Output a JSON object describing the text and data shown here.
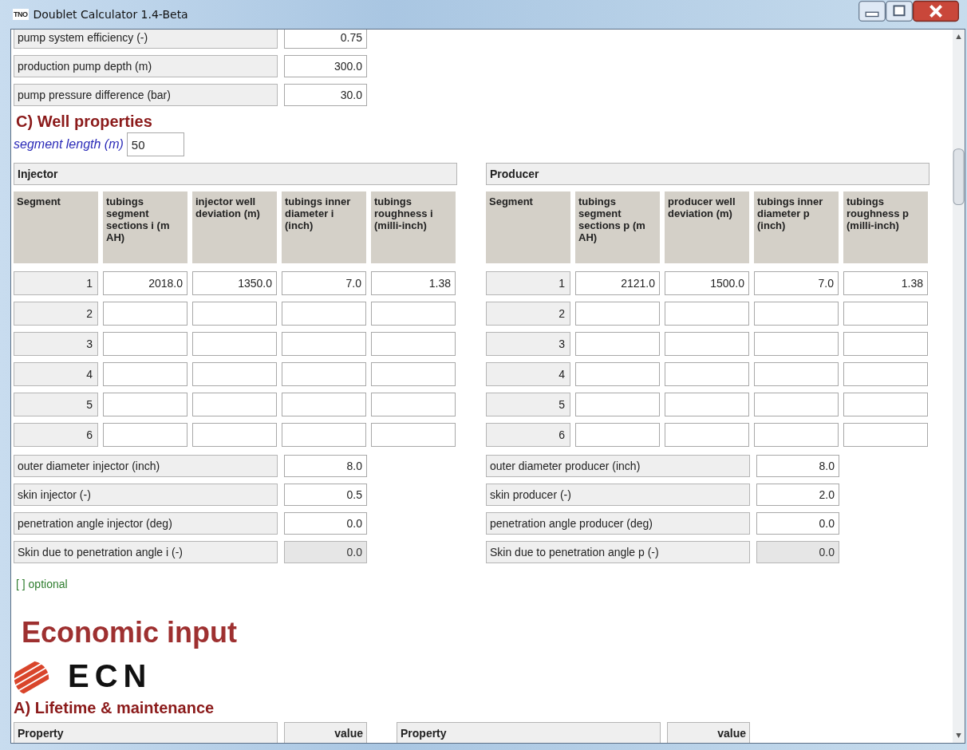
{
  "window": {
    "icon_text": "TNO",
    "title": "Doublet Calculator 1.4-Beta"
  },
  "top_properties": [
    {
      "label": "pump system efficiency (-)",
      "value": "0.75"
    },
    {
      "label": "production pump depth (m)",
      "value": "300.0"
    },
    {
      "label": "pump pressure difference (bar)",
      "value": "30.0"
    }
  ],
  "well_heading": "C) Well properties",
  "segment_length": {
    "label": "segment length (m)",
    "value": "50"
  },
  "wells": [
    {
      "title": "Injector",
      "columns": [
        "Segment",
        "tubings segment sections i (m AH)",
        "injector well deviation (m)",
        "tubings inner diameter i (inch)",
        "tubings roughness i (milli-inch)"
      ],
      "rows": [
        {
          "segment": "1",
          "values": [
            "2018.0",
            "1350.0",
            "7.0",
            "1.38"
          ]
        },
        {
          "segment": "2"
        },
        {
          "segment": "3"
        },
        {
          "segment": "4"
        },
        {
          "segment": "5"
        },
        {
          "segment": "6"
        }
      ],
      "properties": [
        {
          "label": "outer diameter injector (inch)",
          "value": "8.0",
          "readonly": false
        },
        {
          "label": "skin injector (-)",
          "value": "0.5",
          "readonly": false
        },
        {
          "label": "penetration angle injector (deg)",
          "value": "0.0",
          "readonly": false
        },
        {
          "label": "Skin due to penetration angle i (-)",
          "value": "0.0",
          "readonly": true
        }
      ]
    },
    {
      "title": "Producer",
      "columns": [
        "Segment",
        "tubings segment sections p (m AH)",
        "producer well deviation (m)",
        "tubings inner diameter p (inch)",
        "tubings roughness p (milli-inch)"
      ],
      "rows": [
        {
          "segment": "1",
          "values": [
            "2121.0",
            "1500.0",
            "7.0",
            "1.38"
          ]
        },
        {
          "segment": "2"
        },
        {
          "segment": "3"
        },
        {
          "segment": "4"
        },
        {
          "segment": "5"
        },
        {
          "segment": "6"
        }
      ],
      "properties": [
        {
          "label": "outer diameter producer (inch)",
          "value": "8.0",
          "readonly": false
        },
        {
          "label": "skin producer (-)",
          "value": "2.0",
          "readonly": false
        },
        {
          "label": "penetration angle producer (deg)",
          "value": "0.0",
          "readonly": false
        },
        {
          "label": "Skin due to penetration angle p (-)",
          "value": "0.0",
          "readonly": true
        }
      ]
    }
  ],
  "optional_note": "[ ] optional",
  "economic_heading": "Economic input",
  "logo_text": "ECN",
  "lifetime_heading": "A) Lifetime & maintenance",
  "lifetime_columns": [
    "Property",
    "value",
    "Property",
    "value"
  ]
}
